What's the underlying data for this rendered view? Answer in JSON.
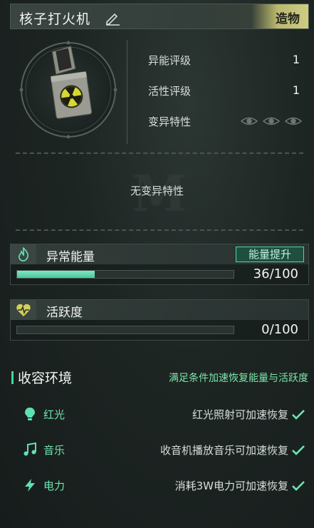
{
  "item": {
    "name": "核子打火机",
    "category": "造物"
  },
  "stats": [
    {
      "label": "异能评级",
      "value": "1"
    },
    {
      "label": "活性评级",
      "value": "1"
    },
    {
      "label": "变异特性",
      "value": ""
    }
  ],
  "mutation_empty_text": "无变异特性",
  "energy": {
    "title": "异常能量",
    "boost_label": "能量提升",
    "value_text": "36/100",
    "fraction": 0.36
  },
  "activity": {
    "title": "活跃度",
    "value_text": "0/100",
    "fraction": 0.0
  },
  "environment": {
    "title": "收容环境",
    "note": "满足条件加速恢复能量与活跃度",
    "items": [
      {
        "icon": "lightbulb-icon",
        "name": "红光",
        "desc": "红光照射可加速恢复"
      },
      {
        "icon": "music-note-icon",
        "name": "音乐",
        "desc": "收音机播放音乐可加速恢复"
      },
      {
        "icon": "lightning-icon",
        "name": "电力",
        "desc": "消耗3W电力可加速恢复"
      }
    ]
  },
  "colors": {
    "accent": "#4fd7a5",
    "tag": "#cfcd84",
    "env_name": "#6fe6b2",
    "note": "#7ee7a9"
  }
}
